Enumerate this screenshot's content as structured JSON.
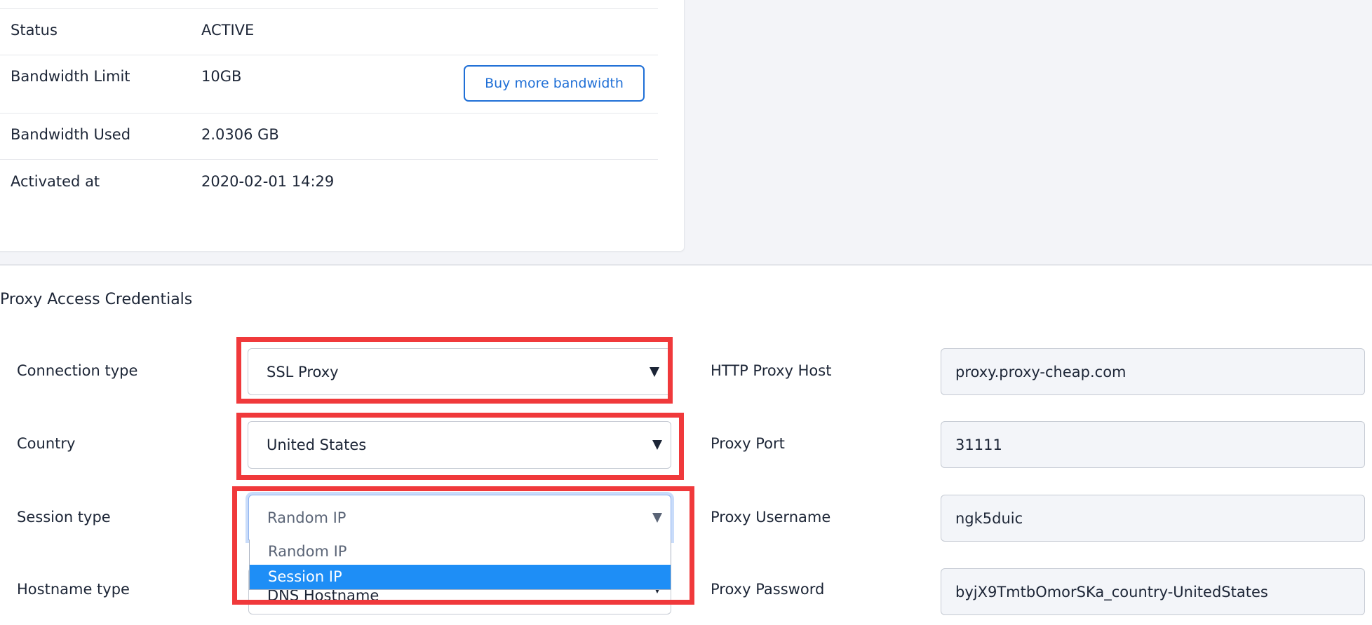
{
  "subscription_details": {
    "rows": [
      {
        "label": "Status",
        "value": "ACTIVE"
      },
      {
        "label": "Bandwidth Limit",
        "value": "10GB"
      },
      {
        "label": "Bandwidth Used",
        "value": "2.0306 GB"
      },
      {
        "label": "Activated at",
        "value": "2020-02-01 14:29"
      }
    ],
    "buy_bandwidth_label": "Buy more bandwidth"
  },
  "credentials": {
    "title": "Proxy Access Credentials",
    "connection_type": {
      "label": "Connection type",
      "value": "SSL Proxy"
    },
    "country": {
      "label": "Country",
      "value": "United States"
    },
    "session_type": {
      "label": "Session type",
      "value": "Random IP",
      "options": [
        "Random IP",
        "Session IP"
      ],
      "highlighted_option": "Session IP"
    },
    "hostname_type": {
      "label": "Hostname type",
      "value": "DNS Hostname"
    },
    "http_proxy_host": {
      "label": "HTTP Proxy Host",
      "value": "proxy.proxy-cheap.com"
    },
    "proxy_port": {
      "label": "Proxy Port",
      "value": "31111"
    },
    "proxy_username": {
      "label": "Proxy Username",
      "value": "ngk5duic"
    },
    "proxy_password": {
      "label": "Proxy Password",
      "value": "byjX9TmtbOmorSKa_country-UnitedStates"
    }
  },
  "colors": {
    "accent": "#1f6fd6",
    "highlight_option": "#1e8ef6",
    "annotation_red": "#f0393b",
    "page_bg": "#f3f4f8"
  }
}
